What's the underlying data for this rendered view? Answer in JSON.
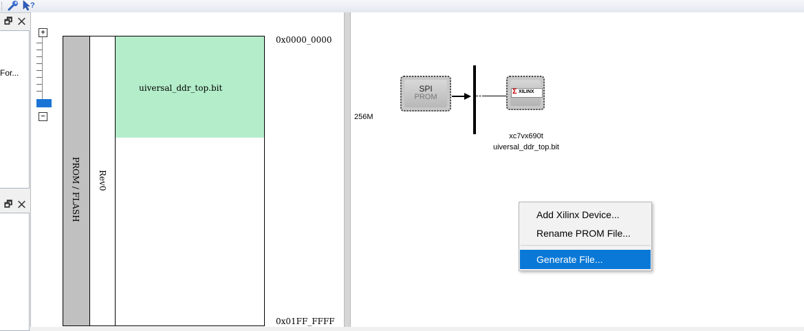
{
  "toolbar": {
    "icons": [
      "wrench-icon",
      "context-help-icon"
    ]
  },
  "left_panels": {
    "top": {
      "buttons": "🗗 ✕",
      "item_label": "For..."
    },
    "bottom": {
      "buttons": "🗗 ✕"
    }
  },
  "memory_view": {
    "zoom_in": "+",
    "zoom_out": "−",
    "device_label": "PROM / FLASH",
    "revision_label": "Rev0",
    "file_block_label": "uiversal_ddr_top.bit",
    "start_address": "0x0000_0000",
    "end_address": "0x01FF_FFFF"
  },
  "diagram": {
    "size_label": "256M",
    "prom_chip": {
      "line1": "SPI",
      "line2": "PROM"
    },
    "fpga_chip": {
      "logo": "XILINX",
      "device": "xc7vx690t",
      "file": "uiversal_ddr_top.bit"
    }
  },
  "context_menu": {
    "items": [
      {
        "label": "Add Xilinx Device...",
        "selected": false
      },
      {
        "label": "Rename PROM File...",
        "selected": false
      },
      {
        "label": "Generate File...",
        "selected": true
      }
    ]
  },
  "colors": {
    "file_block": "#b3edc9",
    "device_bar": "#c0c0c0",
    "menu_highlight": "#0a78d7"
  }
}
